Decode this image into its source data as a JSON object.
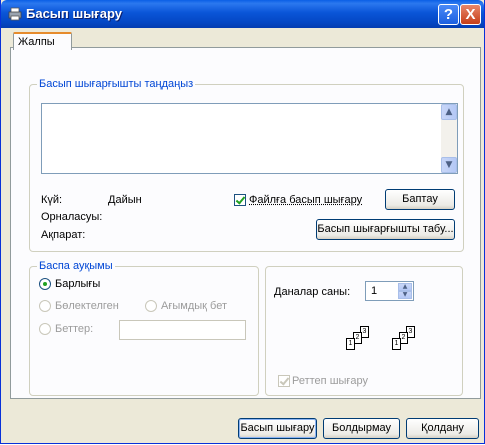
{
  "window": {
    "title": "Басып шығару",
    "help_label": "?",
    "close_label": "X"
  },
  "tabs": [
    {
      "label": "Жалпы",
      "active": true
    }
  ],
  "printer_group": {
    "legend": "Басып шығарғышты таңдаңыз",
    "status_label": "Күй:",
    "status_value": "Дайын",
    "location_label": "Орналасуы:",
    "comment_label": "Ақпарат:",
    "print_to_file_label": "Файлға басып шығару",
    "print_to_file_checked": true,
    "preferences_button": "Баптау",
    "find_printer_button": "Басып шығарғышты табу..."
  },
  "page_range_group": {
    "legend": "Баспа ауқымы",
    "all_label": "Барлығы",
    "selection_label": "Бөлектелген",
    "current_page_label": "Ағымдық бет",
    "pages_label": "Беттер:",
    "pages_value": "",
    "selected_option": "all"
  },
  "copies_group": {
    "copies_label": "Даналар саны:",
    "copies_value": "1",
    "collate_label": "Реттеп шығару",
    "collate_checked": true,
    "collate_enabled": false,
    "collate_icon_numbers": [
      "1",
      "2",
      "3"
    ]
  },
  "footer": {
    "print_button": "Басып шығару",
    "cancel_button": "Болдырмау",
    "apply_button": "Қолдану"
  },
  "colors": {
    "title_bar": "#0a55d8",
    "legend_text": "#0046d5",
    "close_button": "#c63e18"
  }
}
